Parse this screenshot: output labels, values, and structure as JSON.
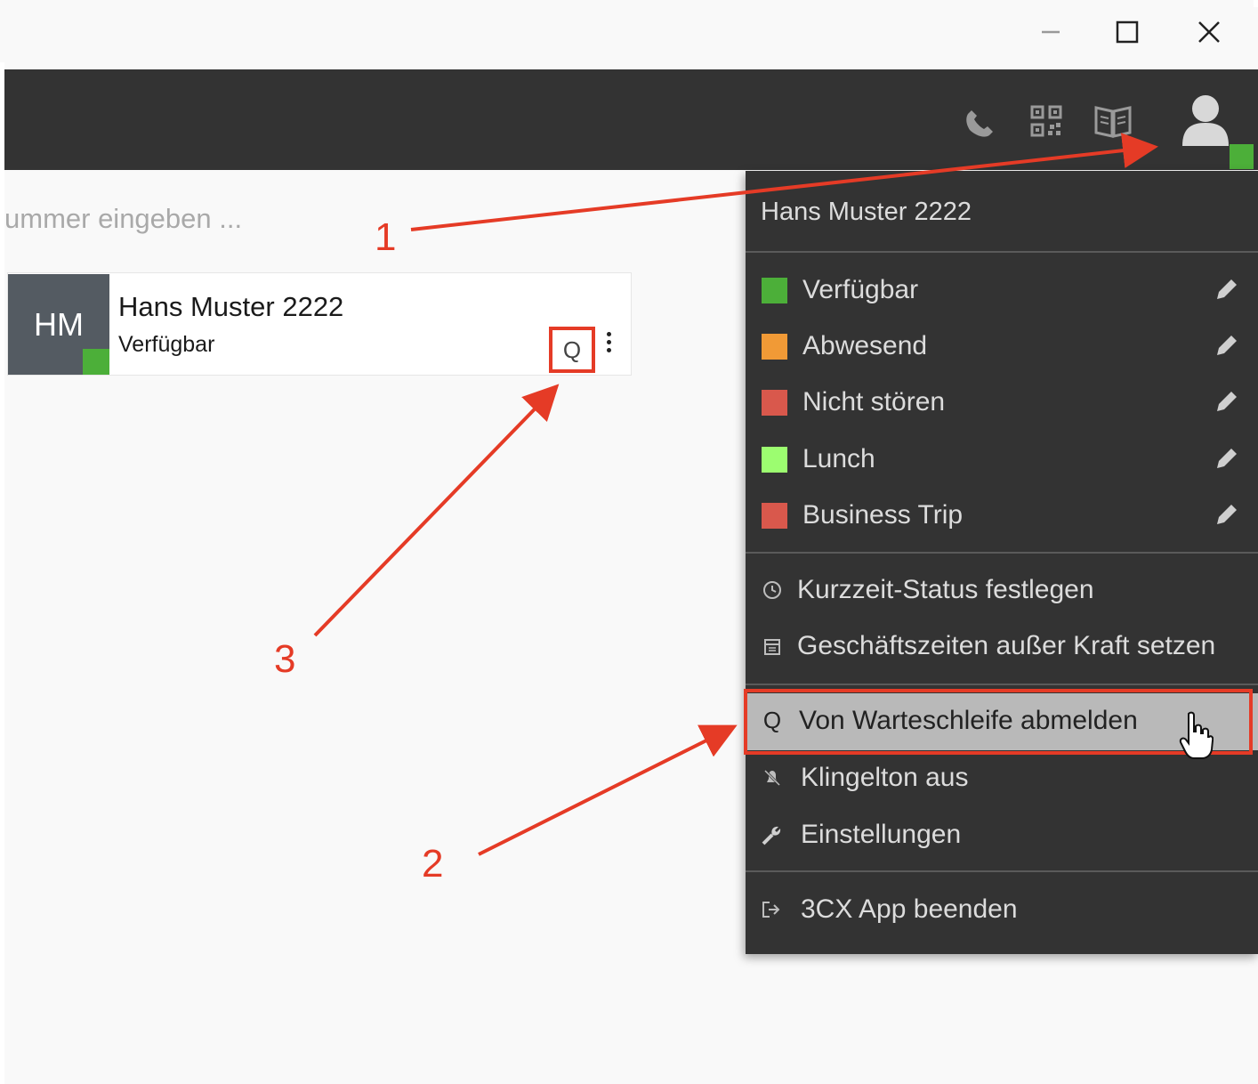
{
  "window_controls": {
    "minimize": "minimize-icon",
    "maximize": "maximize-icon",
    "close": "close-icon"
  },
  "header_icons": [
    "phone-icon",
    "qr-code-icon",
    "phonebook-icon",
    "user-avatar-icon"
  ],
  "search": {
    "placeholder": "ummer eingeben ..."
  },
  "contact": {
    "initials": "HM",
    "name": "Hans Muster 2222",
    "status": "Verfügbar",
    "queue_label": "Q",
    "status_color": "#4caf39"
  },
  "menu": {
    "user": "Hans Muster 2222",
    "statuses": [
      {
        "label": "Verfügbar",
        "color": "#4caf39"
      },
      {
        "label": "Abwesend",
        "color": "#f19a36"
      },
      {
        "label": "Nicht stören",
        "color": "#d9584c"
      },
      {
        "label": "Lunch",
        "color": "#9cfd70"
      },
      {
        "label": "Business Trip",
        "color": "#d9584c"
      }
    ],
    "actions": [
      {
        "label": "Kurzzeit-Status festlegen",
        "icon": "clock-icon"
      },
      {
        "label": "Geschäftszeiten außer Kraft setzen",
        "icon": "calendar-icon"
      },
      {
        "label": "Von Warteschleife abmelden",
        "icon": "queue-icon",
        "glyph": "Q"
      },
      {
        "label": "Klingelton aus",
        "icon": "bell-off-icon"
      },
      {
        "label": "Einstellungen",
        "icon": "wrench-icon"
      },
      {
        "label": "3CX App beenden",
        "icon": "exit-icon"
      }
    ]
  },
  "annotations": [
    "1",
    "2",
    "3"
  ],
  "colors": {
    "annotation": "#e53b26",
    "header_bg": "#333333",
    "menu_bg": "#333333",
    "highlight_bg": "#b9b9b9"
  }
}
